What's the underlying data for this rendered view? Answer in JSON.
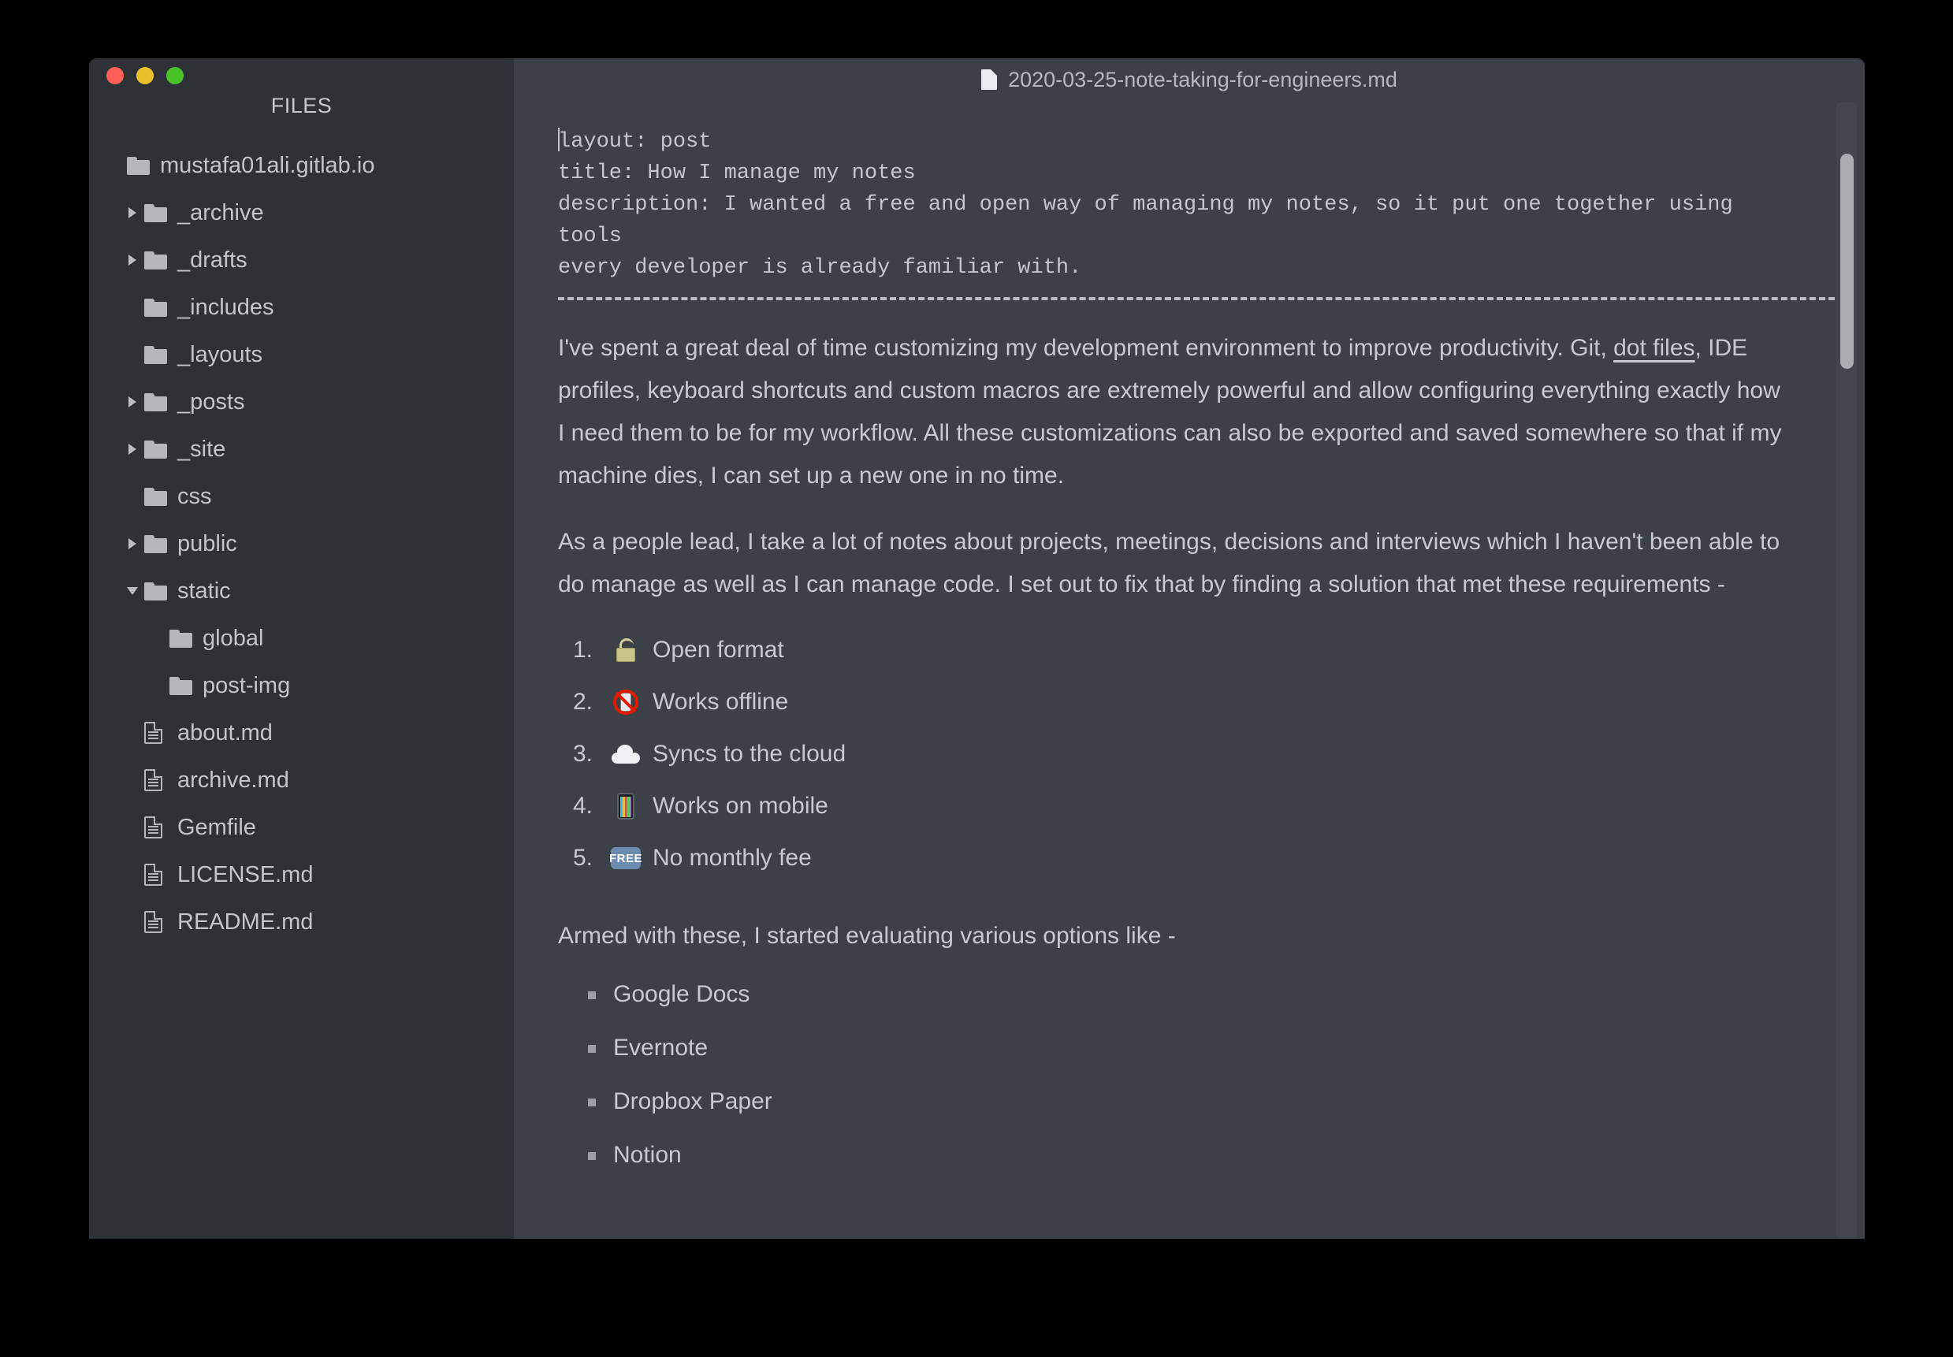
{
  "window": {
    "traffic_lights": [
      {
        "name": "close",
        "color": "#ff5f56"
      },
      {
        "name": "minimize",
        "color": "#e9c229"
      },
      {
        "name": "maximize",
        "color": "#4ac229"
      }
    ]
  },
  "sidebar": {
    "header": "FILES",
    "tree": [
      {
        "label": "mustafa01ali.gitlab.io",
        "type": "folder",
        "depth": 0,
        "twisty": "none"
      },
      {
        "label": "_archive",
        "type": "folder",
        "depth": 1,
        "twisty": "collapsed"
      },
      {
        "label": "_drafts",
        "type": "folder",
        "depth": 1,
        "twisty": "collapsed"
      },
      {
        "label": "_includes",
        "type": "folder",
        "depth": 1,
        "twisty": "none"
      },
      {
        "label": "_layouts",
        "type": "folder",
        "depth": 1,
        "twisty": "none"
      },
      {
        "label": "_posts",
        "type": "folder",
        "depth": 1,
        "twisty": "collapsed"
      },
      {
        "label": "_site",
        "type": "folder",
        "depth": 1,
        "twisty": "collapsed"
      },
      {
        "label": "css",
        "type": "folder",
        "depth": 1,
        "twisty": "none"
      },
      {
        "label": "public",
        "type": "folder",
        "depth": 1,
        "twisty": "collapsed"
      },
      {
        "label": "static",
        "type": "folder",
        "depth": 1,
        "twisty": "expanded"
      },
      {
        "label": "global",
        "type": "folder",
        "depth": 2,
        "twisty": "none"
      },
      {
        "label": "post-img",
        "type": "folder",
        "depth": 2,
        "twisty": "none"
      },
      {
        "label": "about.md",
        "type": "file",
        "depth": 1,
        "twisty": "none"
      },
      {
        "label": "archive.md",
        "type": "file",
        "depth": 1,
        "twisty": "none"
      },
      {
        "label": "Gemfile",
        "type": "file",
        "depth": 1,
        "twisty": "none"
      },
      {
        "label": "LICENSE.md",
        "type": "file",
        "depth": 1,
        "twisty": "none"
      },
      {
        "label": "README.md",
        "type": "file",
        "depth": 1,
        "twisty": "none"
      }
    ]
  },
  "editor": {
    "title": "2020-03-25-note-taking-for-engineers.md",
    "frontmatter": "layout: post\ntitle: How I manage my notes\ndescription: I wanted a free and open way of managing my notes, so it put one together using tools\nevery developer is already familiar with.",
    "paragraph_1_before_link": "I've spent a great deal of time customizing my development environment to improve productivity. Git, ",
    "paragraph_1_link": "dot files",
    "paragraph_1_after_link": ", IDE profiles, keyboard shortcuts and custom macros are extremely powerful and allow configuring everything exactly how I need them to be for my workflow. All these customizations can also be exported and saved somewhere so that if my machine dies, I can set up a new one in no time.",
    "paragraph_2": "As a people lead, I take a lot of notes about projects, meetings, decisions and interviews which I haven't been able to do manage as well as I can manage code. I set out to fix that by finding a solution that met these requirements -",
    "requirements": [
      {
        "num": "1.",
        "emoji": "unlock-emoji",
        "text": "Open format"
      },
      {
        "num": "2.",
        "emoji": "no-mobile-phones-emoji",
        "text": "Works offline"
      },
      {
        "num": "3.",
        "emoji": "cloud-emoji",
        "text": "Syncs to the cloud"
      },
      {
        "num": "4.",
        "emoji": "mobile-phone-emoji",
        "text": "Works on mobile"
      },
      {
        "num": "5.",
        "emoji": "free-emoji",
        "text": "No monthly fee"
      }
    ],
    "paragraph_3": "Armed with these, I started evaluating various options like -",
    "options": [
      "Google Docs",
      "Evernote",
      "Dropbox Paper",
      "Notion"
    ]
  }
}
